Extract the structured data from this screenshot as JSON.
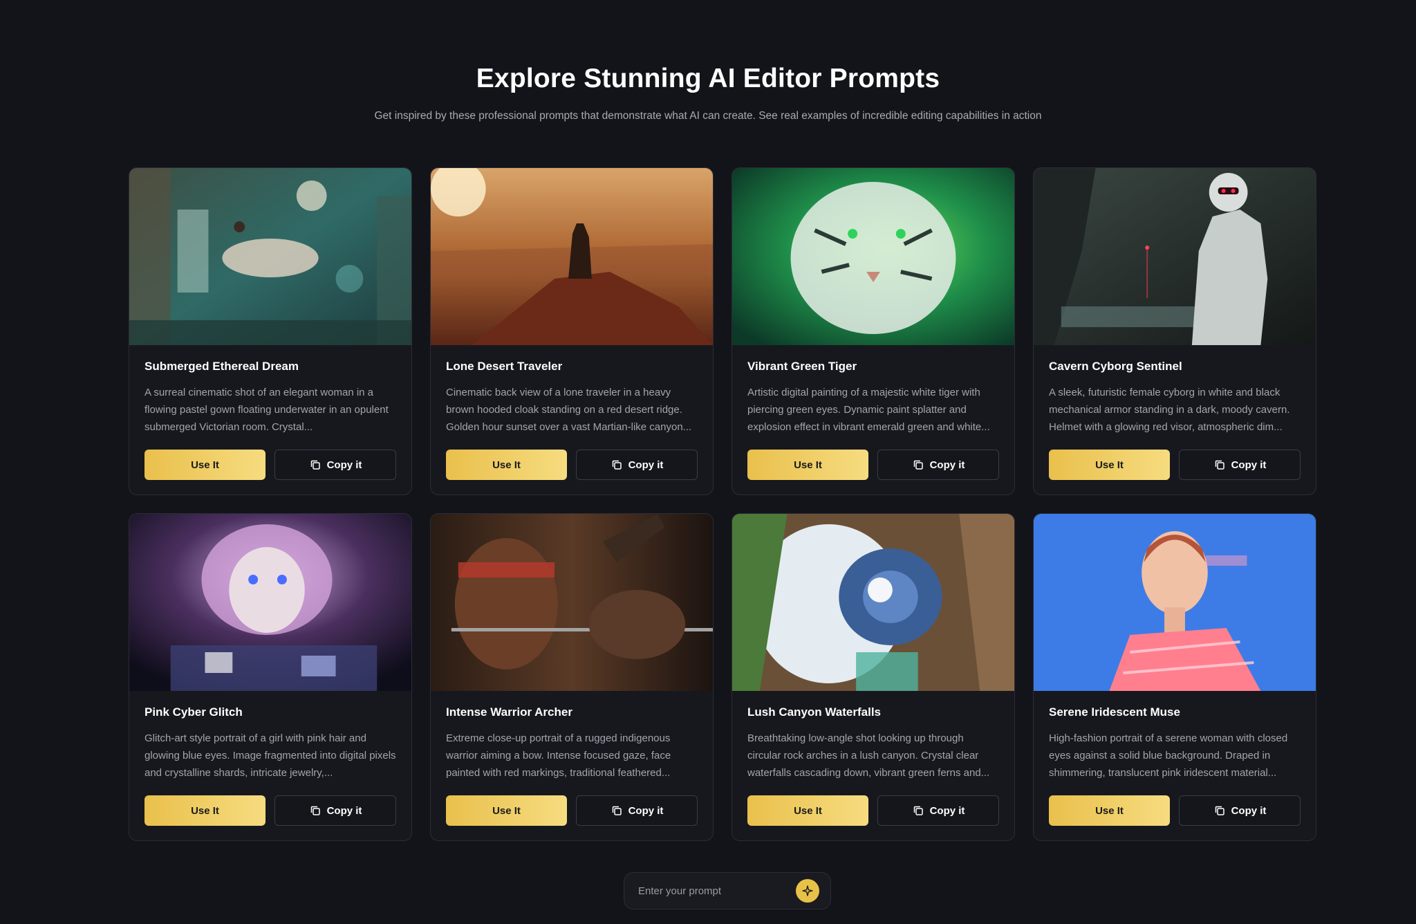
{
  "header": {
    "title": "Explore Stunning AI Editor Prompts",
    "subtitle": "Get inspired by these professional prompts that demonstrate what AI can create. See real examples of incredible editing capabilities in action"
  },
  "cards": [
    {
      "title": "Submerged Ethereal Dream",
      "description": "A surreal cinematic shot of an elegant woman in a flowing pastel gown floating underwater in an opulent submerged Victorian room. Crystal...",
      "use_label": "Use It",
      "copy_label": "Copy it"
    },
    {
      "title": "Lone Desert Traveler",
      "description": "Cinematic back view of a lone traveler in a heavy brown hooded cloak standing on a red desert ridge. Golden hour sunset over a vast Martian-like canyon...",
      "use_label": "Use It",
      "copy_label": "Copy it"
    },
    {
      "title": "Vibrant Green Tiger",
      "description": "Artistic digital painting of a majestic white tiger with piercing green eyes. Dynamic paint splatter and explosion effect in vibrant emerald green and white...",
      "use_label": "Use It",
      "copy_label": "Copy it"
    },
    {
      "title": "Cavern Cyborg Sentinel",
      "description": "A sleek, futuristic female cyborg in white and black mechanical armor standing in a dark, moody cavern. Helmet with a glowing red visor, atmospheric dim...",
      "use_label": "Use It",
      "copy_label": "Copy it"
    },
    {
      "title": "Pink Cyber Glitch",
      "description": "Glitch-art style portrait of a girl with pink hair and glowing blue eyes. Image fragmented into digital pixels and crystalline shards, intricate jewelry,...",
      "use_label": "Use It",
      "copy_label": "Copy it"
    },
    {
      "title": "Intense Warrior Archer",
      "description": "Extreme close-up portrait of a rugged indigenous warrior aiming a bow. Intense focused gaze, face painted with red markings, traditional feathered...",
      "use_label": "Use It",
      "copy_label": "Copy it"
    },
    {
      "title": "Lush Canyon Waterfalls",
      "description": "Breathtaking low-angle shot looking up through circular rock arches in a lush canyon. Crystal clear waterfalls cascading down, vibrant green ferns and...",
      "use_label": "Use It",
      "copy_label": "Copy it"
    },
    {
      "title": "Serene Iridescent Muse",
      "description": "High-fashion portrait of a serene woman with closed eyes against a solid blue background. Draped in shimmering, translucent pink iridescent material...",
      "use_label": "Use It",
      "copy_label": "Copy it"
    }
  ],
  "prompt": {
    "placeholder": "Enter your prompt",
    "submit_icon": "sparkle-icon"
  },
  "colors": {
    "background": "#13141a",
    "card": "#17181e",
    "accent": "#e9c04c"
  }
}
